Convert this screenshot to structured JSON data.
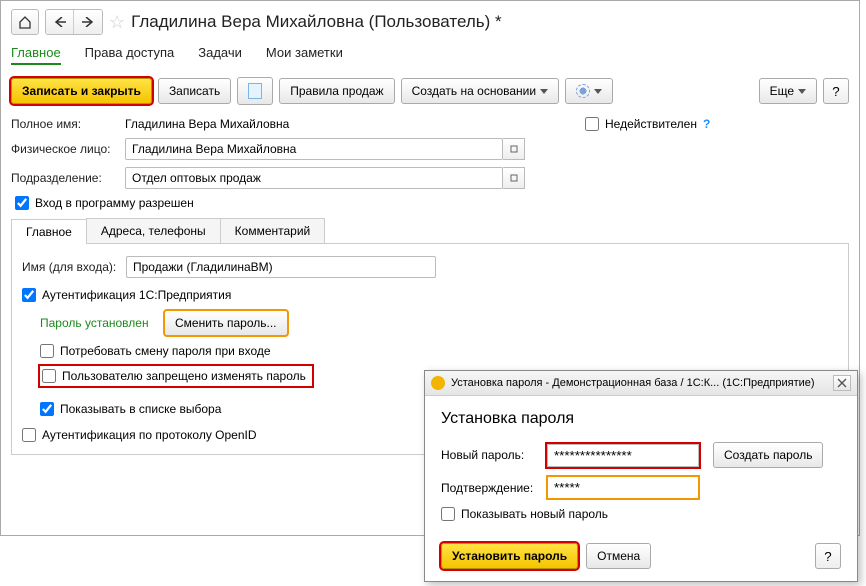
{
  "header": {
    "title": "Гладилина Вера Михайловна (Пользователь) *"
  },
  "top_tabs": {
    "main": "Главное",
    "rights": "Права доступа",
    "tasks": "Задачи",
    "notes": "Мои заметки"
  },
  "toolbar": {
    "save_close": "Записать и закрыть",
    "save": "Записать",
    "sales_rules": "Правила продаж",
    "create_based_on": "Создать на основании",
    "more": "Еще",
    "help": "?"
  },
  "form": {
    "fullname_label": "Полное имя:",
    "fullname_value": "Гладилина Вера Михайловна",
    "inactive_label": "Недействителен",
    "inactive_help": "?",
    "person_label": "Физическое лицо:",
    "person_value": "Гладилина Вера Михайловна",
    "division_label": "Подразделение:",
    "division_value": "Отдел оптовых продаж",
    "login_allowed": "Вход в программу разрешен"
  },
  "sub_tabs": {
    "main": "Главное",
    "addresses": "Адреса, телефоны",
    "comment": "Комментарий"
  },
  "sub_form": {
    "login_label": "Имя (для входа):",
    "login_value": "Продажи (ГладилинаВМ)",
    "auth_1c": "Аутентификация 1С:Предприятия",
    "pass_set_label": "Пароль установлен",
    "change_pass": "Сменить пароль...",
    "require_change": "Потребовать смену пароля при входе",
    "cannot_change": "Пользователю запрещено изменять пароль",
    "show_in_list": "Показывать в списке выбора",
    "auth_openid": "Аутентификация по протоколу OpenID"
  },
  "popup": {
    "titlebar": "Установка пароля - Демонстрационная база / 1С:К... (1С:Предприятие)",
    "heading": "Установка пароля",
    "newpass_label": "Новый пароль:",
    "newpass_value": "***************",
    "confirm_label": "Подтверждение:",
    "confirm_value": "*****",
    "gen_pass": "Создать пароль",
    "show_pass": "Показывать новый пароль",
    "set_btn": "Установить пароль",
    "cancel_btn": "Отмена",
    "help": "?"
  }
}
